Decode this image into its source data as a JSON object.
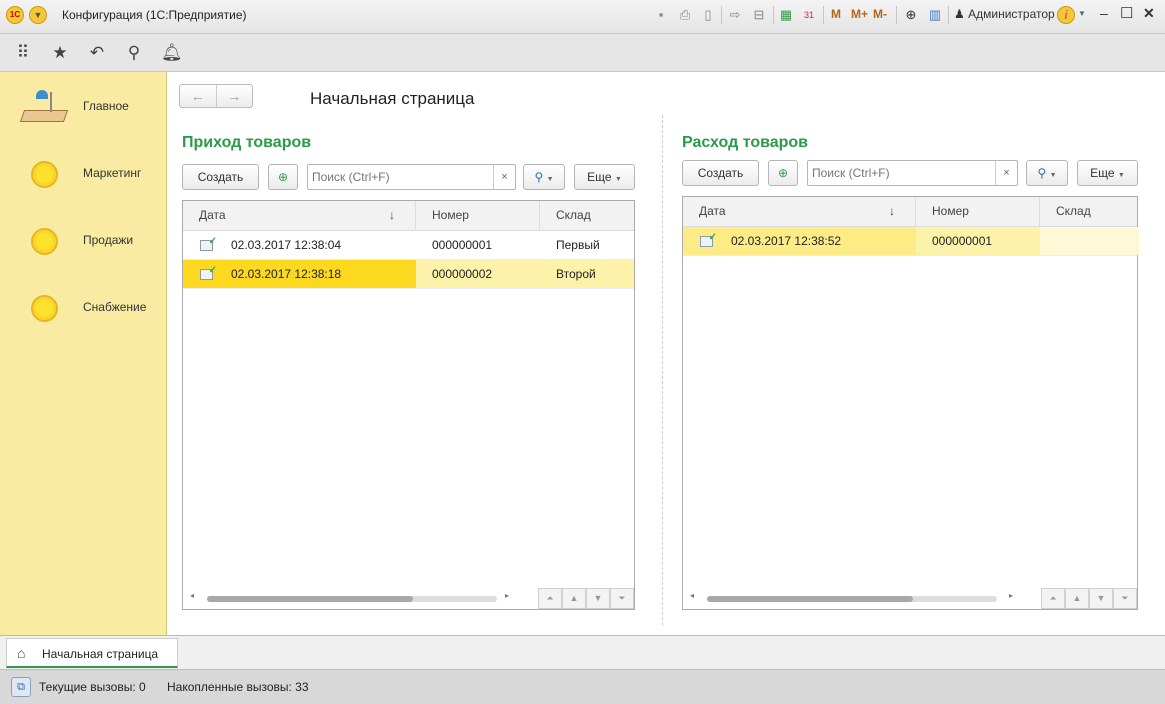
{
  "window": {
    "title": "Конфигурация  (1С:Предприятие)",
    "logo": "1С",
    "user": "Администратор",
    "m": "M",
    "mplus": "M+",
    "mminus": "M-"
  },
  "sidebar": {
    "items": [
      {
        "label": "Главное"
      },
      {
        "label": "Маркетинг"
      },
      {
        "label": "Продажи"
      },
      {
        "label": "Снабжение"
      }
    ]
  },
  "page": {
    "title": "Начальная страница"
  },
  "left": {
    "title": "Приход товаров",
    "create": "Создать",
    "search_placeholder": "Поиск (Ctrl+F)",
    "more": "Еще",
    "columns": [
      "Дата",
      "Номер",
      "Склад"
    ],
    "rows": [
      {
        "date": "02.03.2017 12:38:04",
        "number": "000000001",
        "warehouse": "Первый"
      },
      {
        "date": "02.03.2017 12:38:18",
        "number": "000000002",
        "warehouse": "Второй"
      }
    ]
  },
  "right": {
    "title": "Расход товаров",
    "create": "Создать",
    "search_placeholder": "Поиск (Ctrl+F)",
    "more": "Еще",
    "columns": [
      "Дата",
      "Номер",
      "Склад"
    ],
    "rows": [
      {
        "date": "02.03.2017 12:38:52",
        "number": "000000001",
        "warehouse": ""
      }
    ]
  },
  "tabs": [
    {
      "label": "Начальная страница"
    }
  ],
  "status": {
    "current_calls": "Текущие вызовы: 0",
    "accumulated_calls": "Накопленные вызовы: 33"
  },
  "colors": {
    "accent": "#2b9a4b",
    "sidebar": "#faeba2",
    "selection": "#fcd91f"
  }
}
